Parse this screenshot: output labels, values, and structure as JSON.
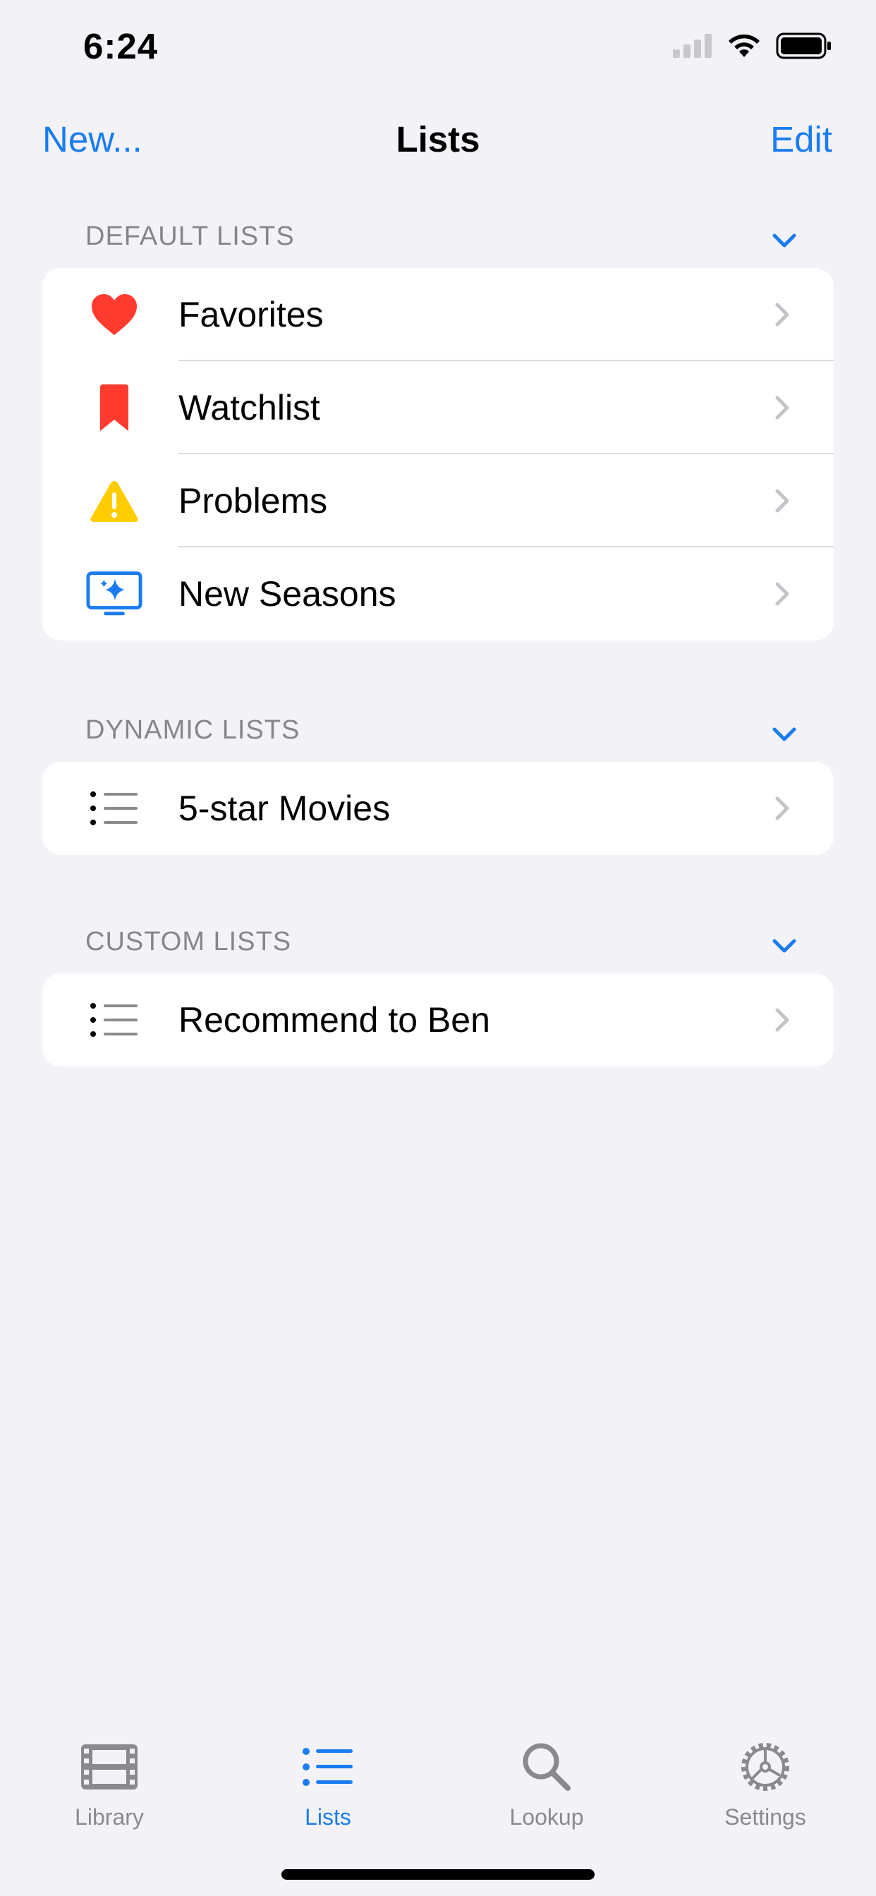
{
  "status_bar": {
    "time": "6:24"
  },
  "nav": {
    "left_label": "New...",
    "title": "Lists",
    "right_label": "Edit"
  },
  "sections": [
    {
      "title": "DEFAULT LISTS",
      "items": [
        {
          "label": "Favorites",
          "icon": "heart-icon"
        },
        {
          "label": "Watchlist",
          "icon": "bookmark-icon"
        },
        {
          "label": "Problems",
          "icon": "warning-icon"
        },
        {
          "label": "New Seasons",
          "icon": "tv-sparkle-icon"
        }
      ]
    },
    {
      "title": "DYNAMIC LISTS",
      "items": [
        {
          "label": "5-star Movies",
          "icon": "list-icon"
        }
      ]
    },
    {
      "title": "CUSTOM LISTS",
      "items": [
        {
          "label": "Recommend to Ben",
          "icon": "list-icon"
        }
      ]
    }
  ],
  "tab_bar": {
    "tabs": [
      {
        "label": "Library",
        "icon": "film-icon",
        "active": false
      },
      {
        "label": "Lists",
        "icon": "list-icon",
        "active": true
      },
      {
        "label": "Lookup",
        "icon": "search-icon",
        "active": false
      },
      {
        "label": "Settings",
        "icon": "gear-icon",
        "active": false
      }
    ]
  },
  "colors": {
    "accent": "#1a7cf0",
    "background": "#f2f2f7",
    "heart": "#ff3b30",
    "bookmark": "#ff3b30",
    "warning": "#ffcc00",
    "secondary_text": "#86868b"
  }
}
